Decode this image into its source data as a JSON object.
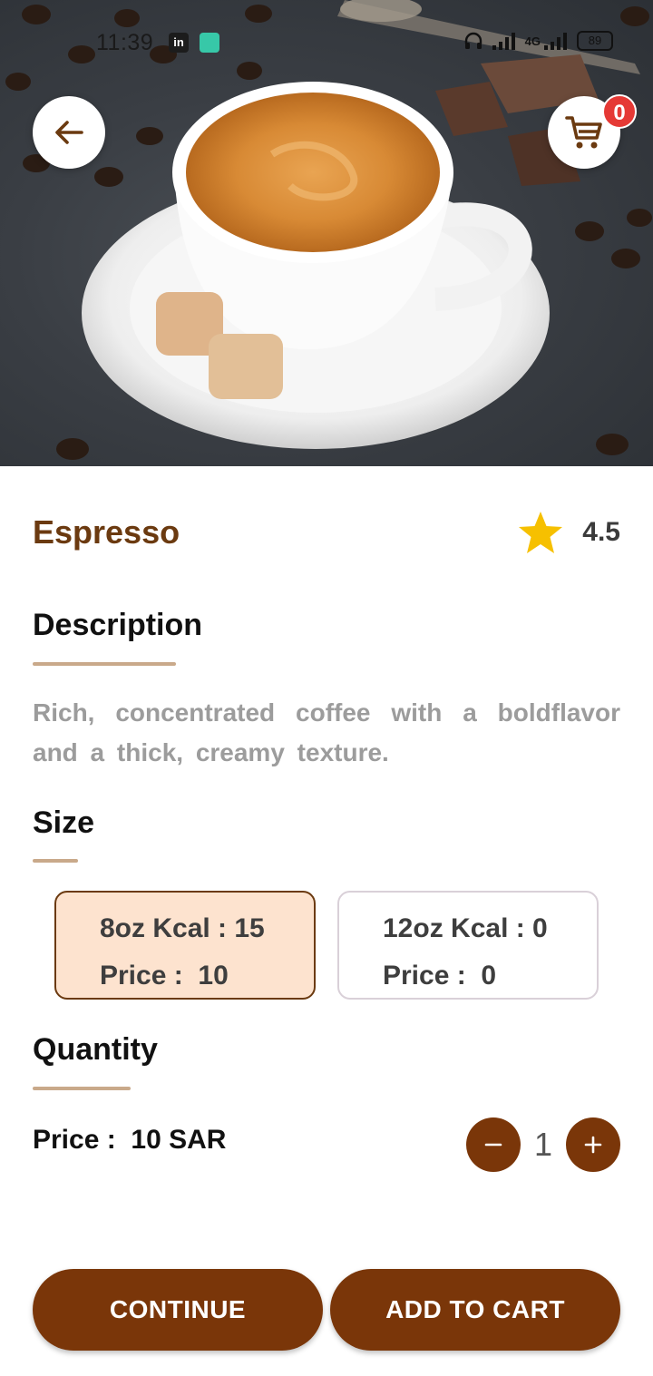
{
  "status_bar": {
    "time": "11:39",
    "linkedin_icon_text": "in",
    "network": "4G",
    "battery": "89"
  },
  "header": {
    "back_icon": "arrow-left-icon",
    "cart_icon": "shopping-cart-icon",
    "cart_count": "0"
  },
  "product": {
    "name": "Espresso",
    "rating": "4.5",
    "rating_icon": "star-icon",
    "description_heading": "Description",
    "description": "Rich, concentrated coffee with a boldflavor and a thick, creamy texture.",
    "size_heading": "Size",
    "sizes": [
      {
        "kcal_line": "8oz Kcal : 15",
        "price_line": "Price :  10",
        "selected": true
      },
      {
        "kcal_line": "12oz Kcal : 0",
        "price_line": "Price :  0",
        "selected": false
      }
    ],
    "quantity_heading": "Quantity",
    "price_line": "Price :  10 SAR",
    "quantity": "1"
  },
  "actions": {
    "continue_label": "CONTINUE",
    "add_to_cart_label": "ADD TO CART"
  },
  "colors": {
    "accent_brown": "#7a3609",
    "title_brown": "#6b3a10",
    "selected_card_bg": "#fde3cf",
    "badge_red": "#e53935",
    "star_yellow": "#f6c000"
  }
}
